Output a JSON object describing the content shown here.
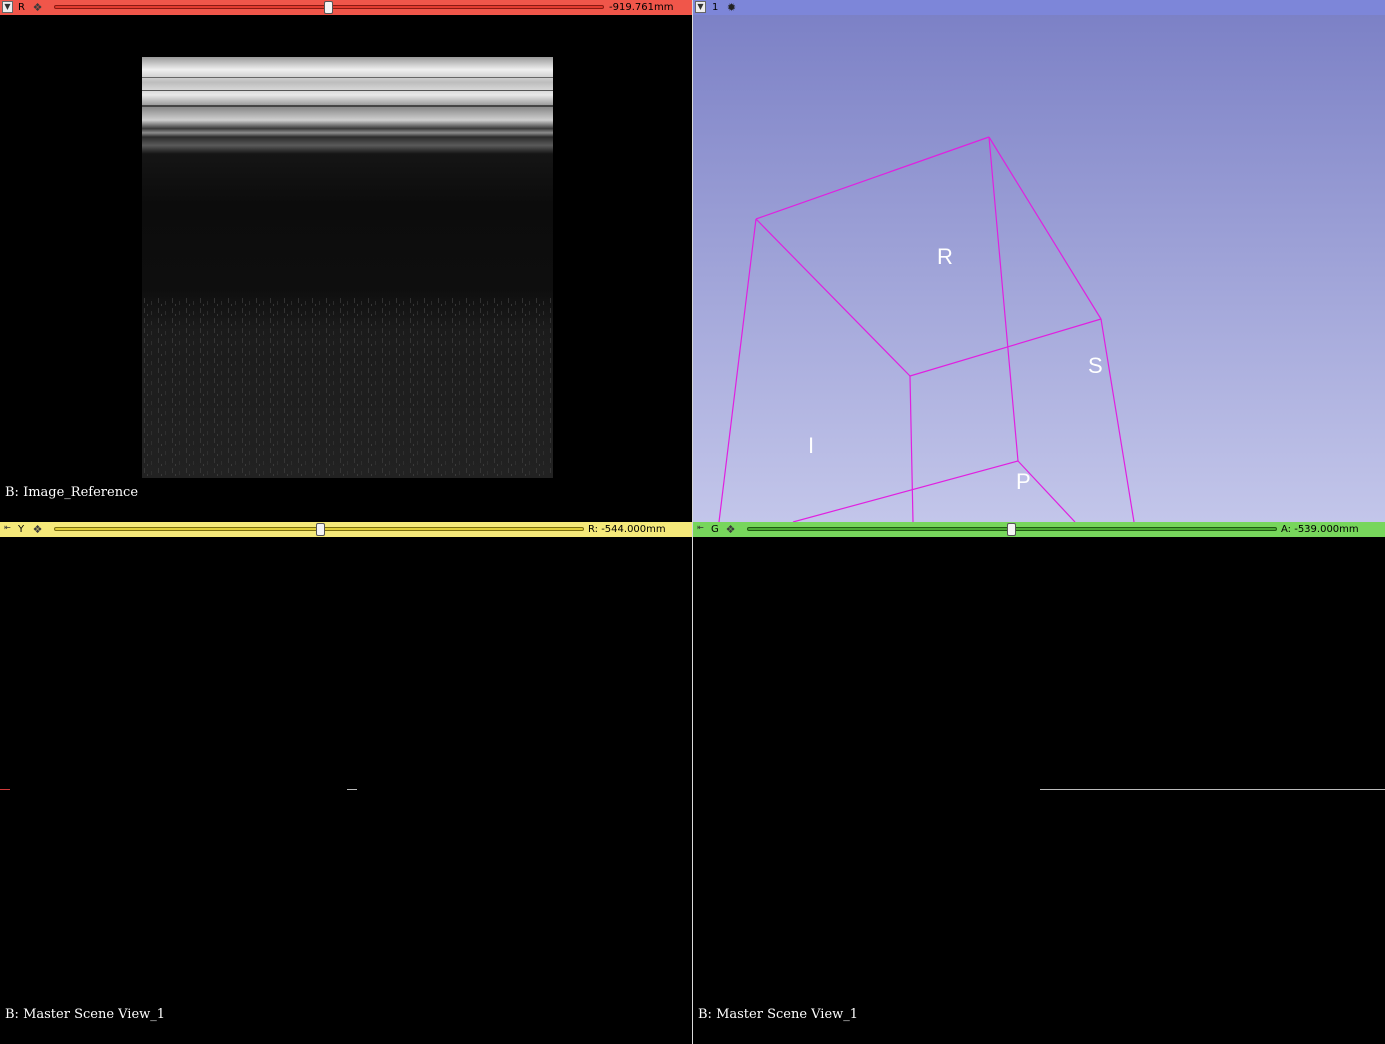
{
  "views": {
    "red": {
      "letter": "R",
      "offset": "-919.761mm",
      "slider_fraction": 0.5,
      "caption": "B: Image_Reference",
      "colors": {
        "bar": "#f0564a",
        "track": "#e33b2f"
      }
    },
    "threed": {
      "index": "1",
      "orientation_labels": {
        "right": "R",
        "superior": "S",
        "inferior": "I",
        "posterior": "P"
      },
      "colors": {
        "bar": "#7d86d9",
        "bg_top": "#7a7fc5",
        "bg_bottom": "#c3c6ea",
        "box": "#e020e0"
      }
    },
    "yellow": {
      "letter": "Y",
      "offset": "R: -544.000mm",
      "slider_fraction": 0.5,
      "caption": "B: Master Scene View_1",
      "colors": {
        "bar": "#f5e97a",
        "track": "#e0cf3a"
      }
    },
    "green": {
      "letter": "G",
      "offset": "A: -539.000mm",
      "slider_fraction": 0.5,
      "caption": "B: Master Scene View_1",
      "colors": {
        "bar": "#77d65c",
        "track": "#4aa833"
      }
    }
  },
  "icons": {
    "pin": "pin-icon",
    "link": "link-icon",
    "center": "center-view-icon"
  }
}
